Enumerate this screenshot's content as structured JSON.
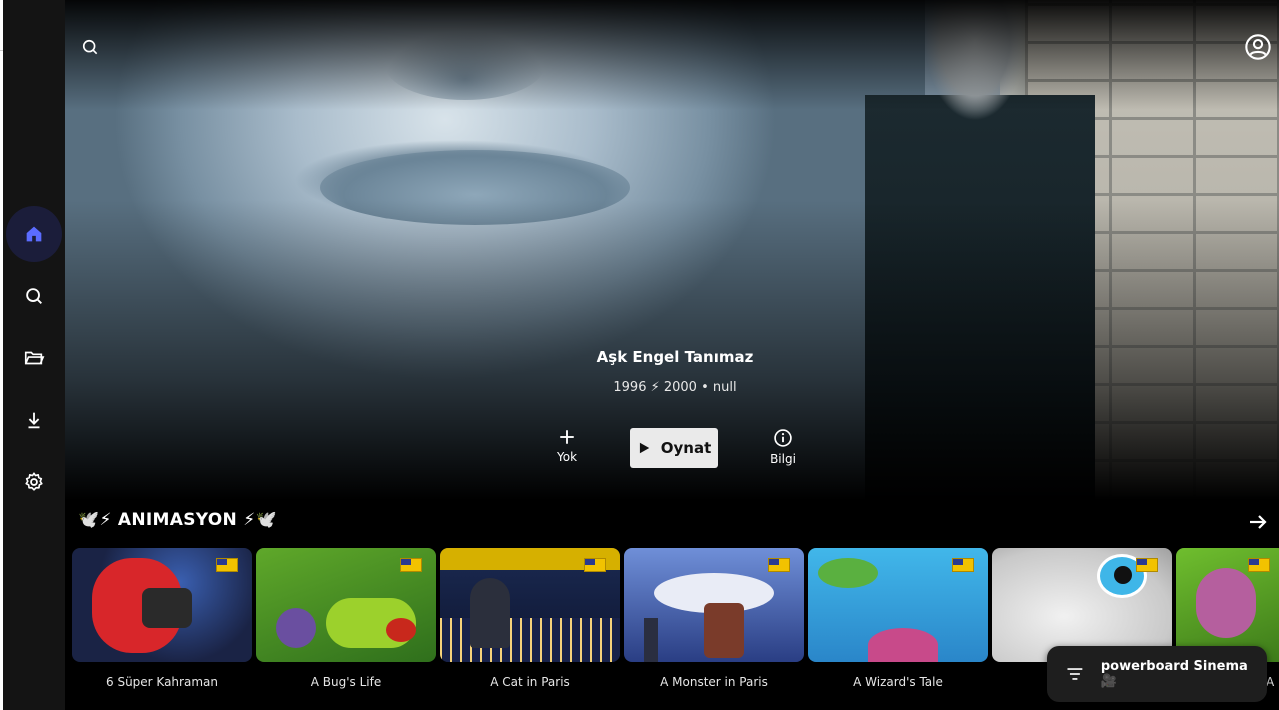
{
  "sidebar": {
    "items": [
      {
        "icon": "home-icon",
        "active": true
      },
      {
        "icon": "search-icon",
        "active": false
      },
      {
        "icon": "folder-icon",
        "active": false
      },
      {
        "icon": "download-icon",
        "active": false
      },
      {
        "icon": "gear-icon",
        "active": false
      }
    ],
    "accent": "#5b6cff"
  },
  "hero": {
    "title": "Aşk Engel Tanımaz",
    "meta": "1996 ⚡ 2000 • null",
    "actions": {
      "add_label": "Yok",
      "play_label": "Oynat",
      "info_label": "Bilgi"
    }
  },
  "row": {
    "title": "🕊️⚡ ANIMASYON ⚡🕊️",
    "items": [
      {
        "title": "6 Süper Kahraman"
      },
      {
        "title": "A Bug's Life"
      },
      {
        "title": "A Cat in Paris"
      },
      {
        "title": "A Monster in Paris"
      },
      {
        "title": "A Wizard's Tale"
      },
      {
        "title": ""
      },
      {
        "title": "A"
      }
    ]
  },
  "toast": {
    "label": "powerboard Sinema 🎥"
  },
  "colors": {
    "background": "#000000",
    "sidebar": "#141414",
    "play_button": "#eaeaea"
  }
}
